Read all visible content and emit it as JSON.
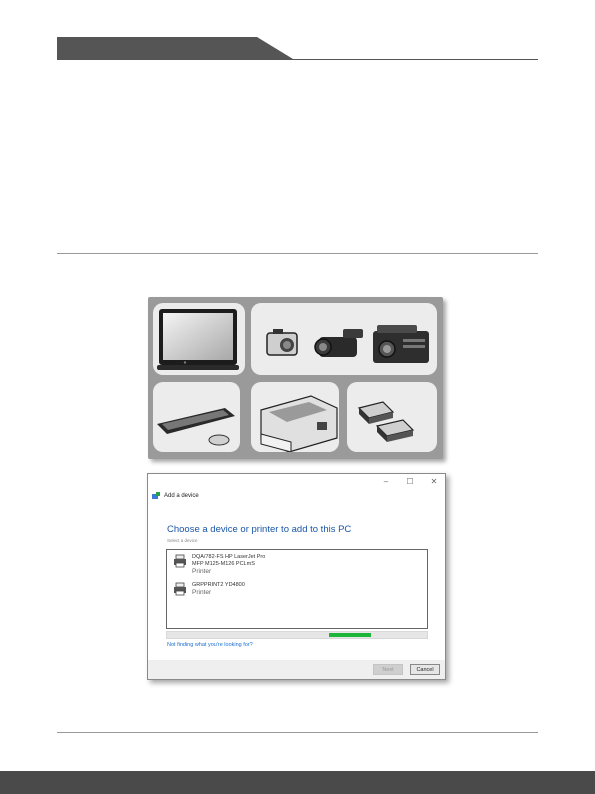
{
  "dialog": {
    "window_controls": [
      "–",
      "☐",
      "✕"
    ],
    "title": "Add a device",
    "heading": "Choose a device or printer to add to this PC",
    "subheading": "Select a device",
    "devices": [
      {
        "name_line1": "DQA/782-FS  HP LaserJet Pro",
        "name_line2": "MFP  M125-M126 PCLmS",
        "type": "Printer"
      },
      {
        "name_line1": "GRPPRINT2   YD4800",
        "name_line2": "",
        "type": "Printer"
      }
    ],
    "progress_fraction": 0.16,
    "link": "Not finding what you're looking for?",
    "next_label": "Next",
    "cancel_label": "Cancel"
  },
  "colors": {
    "heading_blue": "#1a56a8",
    "progress_green": "#1db53a",
    "header_tab": "#555555",
    "footer_bar": "#4a4a4a"
  },
  "icons": [
    "monitor-icon",
    "camera-icon",
    "camcorder-icon",
    "projector-icon",
    "keyboard-icon",
    "mouse-icon",
    "printer-icon",
    "drive-icon"
  ]
}
